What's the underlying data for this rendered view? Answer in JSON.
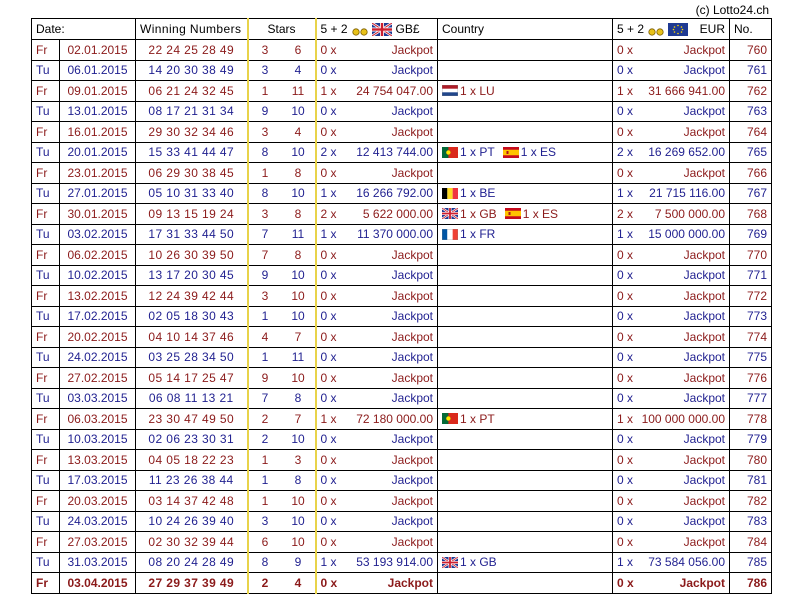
{
  "credit": "(c) Lotto24.ch",
  "headers": {
    "date": "Date:",
    "numbers": "Winning Numbers",
    "stars": "Stars",
    "gb_label": "5 + 2",
    "gb_currency": "GB£",
    "country": "Country",
    "eu_label": "5 + 2",
    "eu_currency": "EUR",
    "no": "No."
  },
  "colors": {
    "fr_row": "#8b1a1a",
    "tu_row": "#1f1f8f",
    "stars_border": "#e8d34a"
  },
  "rows": [
    {
      "day": "Fr",
      "date": "02.01.2015",
      "nums": "22 24 25 28 49",
      "s1": "3",
      "s2": "6",
      "gbc": "0 x",
      "gba": "Jackpot",
      "country": [],
      "euc": "0 x",
      "eua": "Jackpot",
      "no": "760"
    },
    {
      "day": "Tu",
      "date": "06.01.2015",
      "nums": "14 20 30 38 49",
      "s1": "3",
      "s2": "4",
      "gbc": "0 x",
      "gba": "Jackpot",
      "country": [],
      "euc": "0 x",
      "eua": "Jackpot",
      "no": "761"
    },
    {
      "day": "Fr",
      "date": "09.01.2015",
      "nums": "06 21 24 32 45",
      "s1": "1",
      "s2": "11",
      "gbc": "1 x",
      "gba": "24 754 047.00",
      "country": [
        {
          "flag": "nl",
          "text": "1 x LU"
        }
      ],
      "euc": "1 x",
      "eua": "31 666 941.00",
      "no": "762"
    },
    {
      "day": "Tu",
      "date": "13.01.2015",
      "nums": "08 17 21 31 34",
      "s1": "9",
      "s2": "10",
      "gbc": "0 x",
      "gba": "Jackpot",
      "country": [],
      "euc": "0 x",
      "eua": "Jackpot",
      "no": "763"
    },
    {
      "day": "Fr",
      "date": "16.01.2015",
      "nums": "29 30 32 34 46",
      "s1": "3",
      "s2": "4",
      "gbc": "0 x",
      "gba": "Jackpot",
      "country": [],
      "euc": "0 x",
      "eua": "Jackpot",
      "no": "764"
    },
    {
      "day": "Tu",
      "date": "20.01.2015",
      "nums": "15 33 41 44 47",
      "s1": "8",
      "s2": "10",
      "gbc": "2 x",
      "gba": "12 413 744.00",
      "country": [
        {
          "flag": "pt",
          "text": "1 x PT"
        },
        {
          "flag": "es",
          "text": "1 x ES"
        }
      ],
      "euc": "2 x",
      "eua": "16 269 652.00",
      "no": "765"
    },
    {
      "day": "Fr",
      "date": "23.01.2015",
      "nums": "06 29 30 38 45",
      "s1": "1",
      "s2": "8",
      "gbc": "0 x",
      "gba": "Jackpot",
      "country": [],
      "euc": "0 x",
      "eua": "Jackpot",
      "no": "766"
    },
    {
      "day": "Tu",
      "date": "27.01.2015",
      "nums": "05 10 31 33 40",
      "s1": "8",
      "s2": "10",
      "gbc": "1 x",
      "gba": "16 266 792.00",
      "country": [
        {
          "flag": "be",
          "text": "1 x BE"
        }
      ],
      "euc": "1 x",
      "eua": "21 715 116.00",
      "no": "767"
    },
    {
      "day": "Fr",
      "date": "30.01.2015",
      "nums": "09 13 15 19 24",
      "s1": "3",
      "s2": "8",
      "gbc": "2 x",
      "gba": "5 622 000.00",
      "country": [
        {
          "flag": "gb",
          "text": "1 x GB"
        },
        {
          "flag": "es",
          "text": "1 x ES"
        }
      ],
      "euc": "2 x",
      "eua": "7 500 000.00",
      "no": "768"
    },
    {
      "day": "Tu",
      "date": "03.02.2015",
      "nums": "17 31 33 44 50",
      "s1": "7",
      "s2": "11",
      "gbc": "1 x",
      "gba": "11 370 000.00",
      "country": [
        {
          "flag": "fr",
          "text": "1 x FR"
        }
      ],
      "euc": "1 x",
      "eua": "15 000 000.00",
      "no": "769"
    },
    {
      "day": "Fr",
      "date": "06.02.2015",
      "nums": "10 26 30 39 50",
      "s1": "7",
      "s2": "8",
      "gbc": "0 x",
      "gba": "Jackpot",
      "country": [],
      "euc": "0 x",
      "eua": "Jackpot",
      "no": "770"
    },
    {
      "day": "Tu",
      "date": "10.02.2015",
      "nums": "13 17 20 30 45",
      "s1": "9",
      "s2": "10",
      "gbc": "0 x",
      "gba": "Jackpot",
      "country": [],
      "euc": "0 x",
      "eua": "Jackpot",
      "no": "771"
    },
    {
      "day": "Fr",
      "date": "13.02.2015",
      "nums": "12 24 39 42 44",
      "s1": "3",
      "s2": "10",
      "gbc": "0 x",
      "gba": "Jackpot",
      "country": [],
      "euc": "0 x",
      "eua": "Jackpot",
      "no": "772"
    },
    {
      "day": "Tu",
      "date": "17.02.2015",
      "nums": "02 05 18 30 43",
      "s1": "1",
      "s2": "10",
      "gbc": "0 x",
      "gba": "Jackpot",
      "country": [],
      "euc": "0 x",
      "eua": "Jackpot",
      "no": "773"
    },
    {
      "day": "Fr",
      "date": "20.02.2015",
      "nums": "04 10 14 37 46",
      "s1": "4",
      "s2": "7",
      "gbc": "0 x",
      "gba": "Jackpot",
      "country": [],
      "euc": "0 x",
      "eua": "Jackpot",
      "no": "774"
    },
    {
      "day": "Tu",
      "date": "24.02.2015",
      "nums": "03 25 28 34 50",
      "s1": "1",
      "s2": "11",
      "gbc": "0 x",
      "gba": "Jackpot",
      "country": [],
      "euc": "0 x",
      "eua": "Jackpot",
      "no": "775"
    },
    {
      "day": "Fr",
      "date": "27.02.2015",
      "nums": "05 14 17 25 47",
      "s1": "9",
      "s2": "10",
      "gbc": "0 x",
      "gba": "Jackpot",
      "country": [],
      "euc": "0 x",
      "eua": "Jackpot",
      "no": "776"
    },
    {
      "day": "Tu",
      "date": "03.03.2015",
      "nums": "06 08 11 13 21",
      "s1": "7",
      "s2": "8",
      "gbc": "0 x",
      "gba": "Jackpot",
      "country": [],
      "euc": "0 x",
      "eua": "Jackpot",
      "no": "777"
    },
    {
      "day": "Fr",
      "date": "06.03.2015",
      "nums": "23 30 47 49 50",
      "s1": "2",
      "s2": "7",
      "gbc": "1 x",
      "gba": "72 180 000.00",
      "country": [
        {
          "flag": "pt",
          "text": "1 x PT"
        }
      ],
      "euc": "1 x",
      "eua": "100 000 000.00",
      "no": "778"
    },
    {
      "day": "Tu",
      "date": "10.03.2015",
      "nums": "02 06 23 30 31",
      "s1": "2",
      "s2": "10",
      "gbc": "0 x",
      "gba": "Jackpot",
      "country": [],
      "euc": "0 x",
      "eua": "Jackpot",
      "no": "779"
    },
    {
      "day": "Fr",
      "date": "13.03.2015",
      "nums": "04 05 18 22 23",
      "s1": "1",
      "s2": "3",
      "gbc": "0 x",
      "gba": "Jackpot",
      "country": [],
      "euc": "0 x",
      "eua": "Jackpot",
      "no": "780"
    },
    {
      "day": "Tu",
      "date": "17.03.2015",
      "nums": "11 23 26 38 44",
      "s1": "1",
      "s2": "8",
      "gbc": "0 x",
      "gba": "Jackpot",
      "country": [],
      "euc": "0 x",
      "eua": "Jackpot",
      "no": "781"
    },
    {
      "day": "Fr",
      "date": "20.03.2015",
      "nums": "03 14 37 42 48",
      "s1": "1",
      "s2": "10",
      "gbc": "0 x",
      "gba": "Jackpot",
      "country": [],
      "euc": "0 x",
      "eua": "Jackpot",
      "no": "782"
    },
    {
      "day": "Tu",
      "date": "24.03.2015",
      "nums": "10 24 26 39 40",
      "s1": "3",
      "s2": "10",
      "gbc": "0 x",
      "gba": "Jackpot",
      "country": [],
      "euc": "0 x",
      "eua": "Jackpot",
      "no": "783"
    },
    {
      "day": "Fr",
      "date": "27.03.2015",
      "nums": "02 30 32 39 44",
      "s1": "6",
      "s2": "10",
      "gbc": "0 x",
      "gba": "Jackpot",
      "country": [],
      "euc": "0 x",
      "eua": "Jackpot",
      "no": "784"
    },
    {
      "day": "Tu",
      "date": "31.03.2015",
      "nums": "08 20 24 28 49",
      "s1": "8",
      "s2": "9",
      "gbc": "1 x",
      "gba": "53 193 914.00",
      "country": [
        {
          "flag": "gb",
          "text": "1 x GB"
        }
      ],
      "euc": "1 x",
      "eua": "73 584 056.00",
      "no": "785"
    },
    {
      "day": "Fr",
      "date": "03.04.2015",
      "nums": "27 29 37 39 49",
      "s1": "2",
      "s2": "4",
      "gbc": "0 x",
      "gba": "Jackpot",
      "country": [],
      "euc": "0 x",
      "eua": "Jackpot",
      "no": "786",
      "last": true
    }
  ]
}
